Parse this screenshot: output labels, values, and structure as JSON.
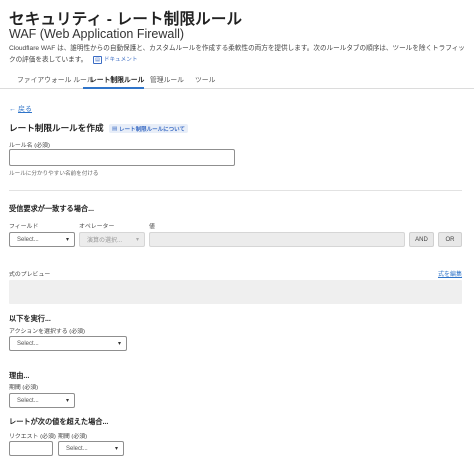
{
  "page": {
    "title": "セキュリティ - レート制限ルール",
    "subtitle": "WAF (Web Application Firewall)",
    "description": "Cloudflare WAF は、誰明性からの自動保護と、カスタムルールを作成する柔軟性の両方を提供します。次のルールタブの順序は、ツールを除くトラフィックの評価を表しています。",
    "doc_link_icon": "doc-icon",
    "doc_link": "ドキュメント"
  },
  "tabs": [
    {
      "label": "ファイアウォール ルール",
      "active": false
    },
    {
      "label": "レート制限ルール",
      "active": true
    },
    {
      "label": "管理ルール",
      "active": false
    },
    {
      "label": "ツール",
      "active": false
    }
  ],
  "colors": {
    "accent": "#2f74c9",
    "pill_bg": "#e8eef8"
  },
  "form": {
    "back_label": "戻る",
    "heading": "レート制限ルールを作成",
    "about_pill": "レート制限ルールについて",
    "rule_name_label": "ルール名 (必須)",
    "rule_name_value": "",
    "rule_name_help": "ルールに分かりやすい名前を付ける",
    "incoming": {
      "heading": "受信要求が一致する場合...",
      "field_label": "フィールド",
      "field_value": "Select...",
      "operator_label": "オペレーター",
      "operator_value": "演算の選択...",
      "value_label": "値",
      "and_label": "AND",
      "or_label": "OR"
    },
    "preview": {
      "label": "式のプレビュー",
      "edit_link": "式を編集"
    },
    "then": {
      "heading": "以下を実行...",
      "action_label": "アクションを選択する (必須)",
      "action_value": "Select..."
    },
    "reason": {
      "heading": "理由...",
      "duration_label": "期間 (必須)",
      "duration_value": "Select..."
    },
    "rate": {
      "heading": "レートが次の値を超えた場合...",
      "requests_label": "リクエスト (必須)",
      "period_label": "期間 (必須)",
      "period_value": "Select..."
    }
  }
}
